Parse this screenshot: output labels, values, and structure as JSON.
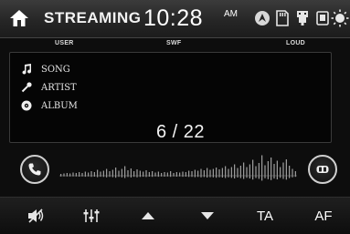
{
  "header": {
    "title": "STREAMING",
    "time": "10:28",
    "ampm": "AM"
  },
  "sub_labels": {
    "user": "USER",
    "swf": "SWF",
    "loud": "LOUD"
  },
  "track": {
    "song": "SONG",
    "artist": "ARTIST",
    "album": "ALBUM",
    "count": "6 / 22"
  },
  "waveform": {
    "levels": [
      0.08,
      0.1,
      0.12,
      0.1,
      0.14,
      0.12,
      0.16,
      0.12,
      0.18,
      0.14,
      0.2,
      0.16,
      0.26,
      0.18,
      0.22,
      0.3,
      0.2,
      0.26,
      0.36,
      0.22,
      0.3,
      0.42,
      0.24,
      0.32,
      0.2,
      0.28,
      0.22,
      0.18,
      0.24,
      0.16,
      0.2,
      0.14,
      0.18,
      0.12,
      0.16,
      0.14,
      0.2,
      0.12,
      0.16,
      0.14,
      0.18,
      0.16,
      0.22,
      0.2,
      0.26,
      0.22,
      0.3,
      0.24,
      0.34,
      0.26,
      0.3,
      0.36,
      0.28,
      0.34,
      0.42,
      0.3,
      0.38,
      0.5,
      0.34,
      0.44,
      0.58,
      0.38,
      0.5,
      0.7,
      0.42,
      0.56,
      0.9,
      0.46,
      0.64,
      0.8,
      0.52,
      0.66,
      0.38,
      0.58,
      0.72,
      0.44,
      0.3,
      0.2
    ]
  },
  "bottom_bar": {
    "ta": "TA",
    "af": "AF"
  }
}
